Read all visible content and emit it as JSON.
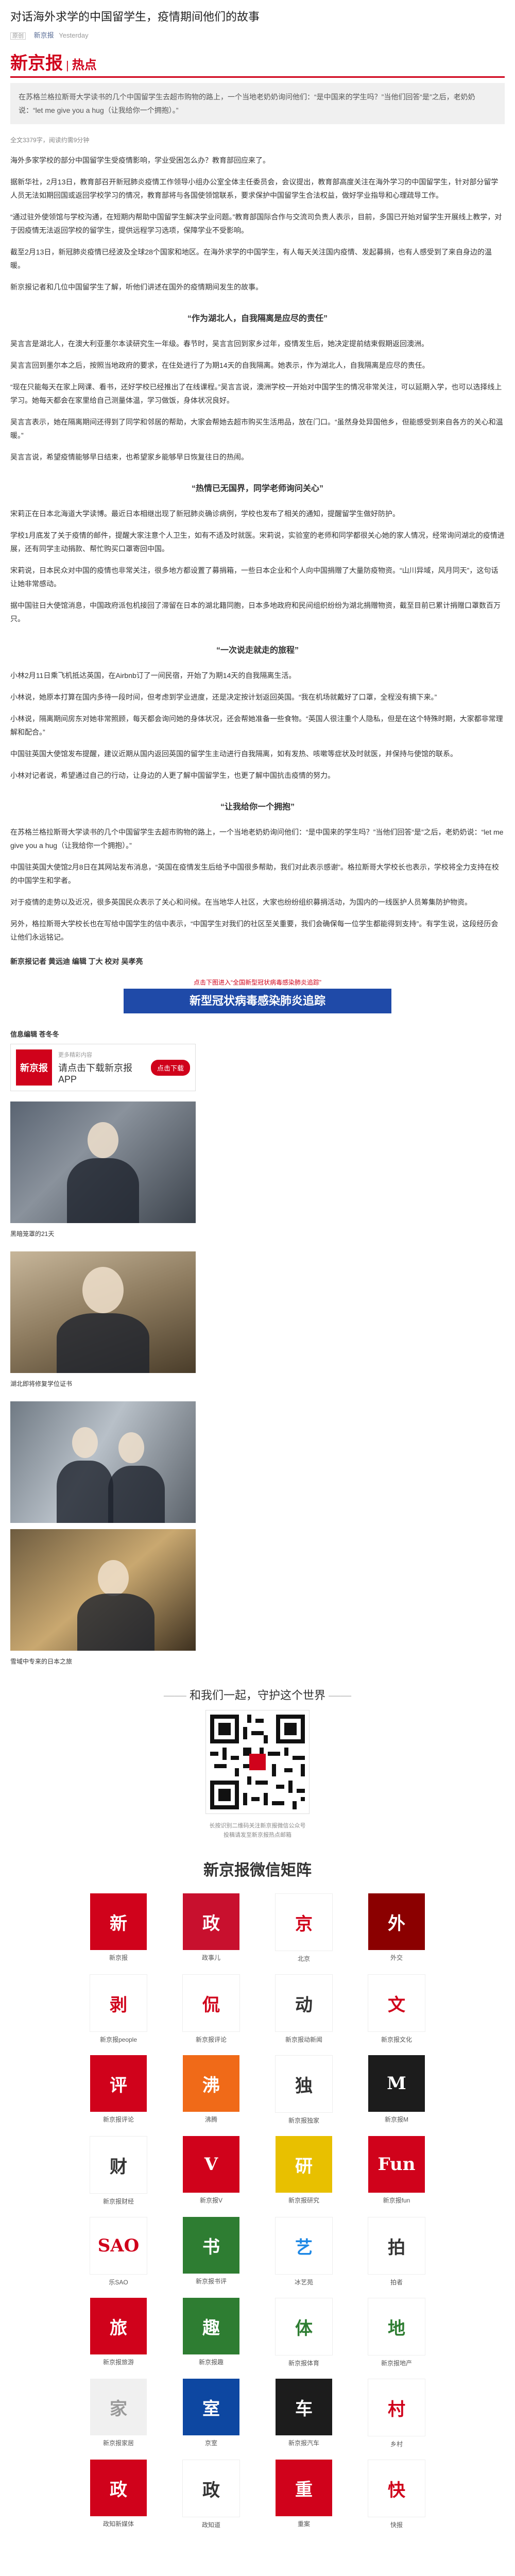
{
  "header": {
    "title": "对话海外求学的中国留学生，疫情期间他们的故事",
    "original_tag": "原创",
    "source": "新京报",
    "date": "Yesterday"
  },
  "brand": {
    "logo": "新京报",
    "section": "热点"
  },
  "summary": "在苏格兰格拉斯哥大学读书的几个中国留学生去超市购物的路上，一个当地老奶奶询问他们：“是中国来的学生吗？”当他们回答“是”之后，老奶奶说：“let me give you a hug（让我给你一个拥抱）。”",
  "note": "全文3379字，阅读约需9分钟",
  "paragraphs_a": [
    "海外多家学校的部分中国留学生受疫情影响，学业受困怎么办？教育部回应来了。",
    "据新华社，2月13日，教育部召开新冠肺炎疫情工作领导小组办公室全体主任委员会，会议提出，教育部高度关注在海外学习的中国留学生，针对部分留学人员无法如期回国或返回学校学习的情况，教育部将与各国使领馆联系，要求保护中国留学生合法权益，做好学业指导和心理疏导工作。",
    "“通过驻外使领馆与学校沟通，在短期内帮助中国留学生解决学业问题。”教育部国际合作与交流司负责人表示，目前，多国已开始对留学生开展线上教学，对于因疫情无法返回学校的留学生，提供远程学习选项，保障学业不受影响。",
    "截至2月13日，新冠肺炎疫情已经波及全球28个国家和地区。在海外求学的中国学生，有人每天关注国内疫情、发起募捐，也有人感受到了来自身边的温暖。",
    "新京报记者和几位中国留学生了解，听他们讲述在国外的疫情期间发生的故事。"
  ],
  "section1": {
    "heading": "“作为湖北人，自我隔离是应尽的责任”",
    "paragraphs": [
      "吴言言是湖北人，在澳大利亚墨尔本读研究生一年级。春节时，吴言言回到家乡过年，疫情发生后，她决定提前结束假期返回澳洲。",
      "吴言言回到墨尔本之后，按照当地政府的要求，在住处进行了为期14天的自我隔离。她表示，作为湖北人，自我隔离是应尽的责任。",
      "“现在只能每天在家上网课、看书，还好学校已经推出了在线课程。”吴言言说，澳洲学校一开始对中国学生的情况非常关注，可以延期入学，也可以选择线上学习。她每天都会在家里给自己测量体温，学习做饭，身体状况良好。",
      "吴言言表示，她在隔离期间还得到了同学和邻居的帮助，大家会帮她去超市购买生活用品，放在门口。“虽然身处异国他乡，但能感受到来自各方的关心和温暖。”",
      "吴言言说，希望疫情能够早日结束，也希望家乡能够早日恢复往日的热闹。"
    ]
  },
  "section2": {
    "heading": "“热情已无国界，同学老师询问关心”",
    "paragraphs": [
      "宋莉正在日本北海道大学读博。最近日本相继出现了新冠肺炎确诊病例，学校也发布了相关的通知，提醒留学生做好防护。",
      "学校1月底发了关于疫情的邮件，提醒大家注意个人卫生，如有不适及时就医。宋莉说，实验室的老师和同学都很关心她的家人情况，经常询问湖北的疫情进展，还有同学主动捐款、帮忙购买口罩寄回中国。",
      "宋莉说，日本民众对中国的疫情也非常关注，很多地方都设置了募捐箱，一些日本企业和个人向中国捐赠了大量防疫物资。“山川异域，风月同天”，这句话让她非常感动。",
      "据中国驻日大使馆消息，中国政府派包机接回了滞留在日本的湖北籍同胞，日本多地政府和民间组织纷纷为湖北捐赠物资，截至目前已累计捐赠口罩数百万只。"
    ]
  },
  "section3": {
    "heading": "“一次说走就走的旅程”",
    "paragraphs": [
      "小林2月11日乘飞机抵达英国，在Airbnb订了一间民宿，开始了为期14天的自我隔离生活。",
      "小林说，她原本打算在国内多待一段时间，但考虑到学业进度，还是决定按计划返回英国。“我在机场就戴好了口罩，全程没有摘下来。”",
      "小林说，隔离期间房东对她非常照顾，每天都会询问她的身体状况，还会帮她准备一些食物。“英国人很注重个人隐私，但是在这个特殊时期，大家都非常理解和配合。”",
      "中国驻英国大使馆发布提醒，建议近期从国内返回英国的留学生主动进行自我隔离，如有发热、咳嗽等症状及时就医，并保持与使馆的联系。",
      "小林对记者说，希望通过自己的行动，让身边的人更了解中国留学生，也更了解中国抗击疫情的努力。"
    ]
  },
  "section4": {
    "heading": "“让我给你一个拥抱”",
    "paragraphs": [
      "在苏格兰格拉斯哥大学读书的几个中国留学生去超市购物的路上，一个当地老奶奶询问他们：“是中国来的学生吗？”当他们回答“是”之后，老奶奶说：“let me give you a hug（让我给你一个拥抱）。”",
      "中国驻英国大使馆2月8日在其网站发布消息，“英国在疫情发生后给予中国很多帮助，我们对此表示感谢”。格拉斯哥大学校长也表示，学校将全力支持在校的中国学生和学者。",
      "对于疫情的走势以及近况，很多英国民众表示了关心和问候。在当地华人社区，大家也纷纷组织募捐活动，为国内的一线医护人员筹集防护物资。",
      "另外，格拉斯哥大学校长也在写给中国学生的信中表示，“中国学生对我们的社区至关重要，我们会确保每一位学生都能得到支持”。有学生说，这段经历会让他们永远铭记。"
    ]
  },
  "tags": "新京报记者 黄远迪 编辑 丁大 校对 吴孝亮",
  "banner": {
    "top": "点击下图进入“全国新型冠状病毒感染肺炎追踪”",
    "main": "新型冠状病毒感染肺炎追踪"
  },
  "captions": {
    "c1": "信息编辑 苍冬冬",
    "app_small": "更多精彩内容",
    "app_big": "请点击下载新京报APP",
    "app_btn": "点击下载",
    "c2": "黑暗笼罩的21天",
    "c3": "湖北即将修复学位证书",
    "c4": "雪域中专来的日本之旅"
  },
  "promo": {
    "heading": "和我们一起，守护这个世界",
    "qr_line1": "长按识别二维码关注新京报微信公众号",
    "qr_line2": "投稿请发至新京报热点邮箱"
  },
  "matrix": {
    "title": "新京报微信矩阵",
    "items": [
      {
        "logo": "新",
        "name": "新京报",
        "bg": "#d0021b",
        "fg": "#ffffff"
      },
      {
        "logo": "政",
        "name": "政事儿",
        "bg": "#c8102e",
        "fg": "#ffffff"
      },
      {
        "logo": "京",
        "name": "北京",
        "bg": "#ffffff",
        "fg": "#d0021b"
      },
      {
        "logo": "外",
        "name": "外交",
        "bg": "#8b0000",
        "fg": "#ffffff"
      },
      {
        "logo": "剥",
        "name": "新京报people",
        "bg": "#ffffff",
        "fg": "#d0021b"
      },
      {
        "logo": "侃",
        "name": "新京报评论",
        "bg": "#ffffff",
        "fg": "#d0021b"
      },
      {
        "logo": "动",
        "name": "新京报动新闻",
        "bg": "#ffffff",
        "fg": "#333333"
      },
      {
        "logo": "文",
        "name": "新京报文化",
        "bg": "#ffffff",
        "fg": "#d0021b"
      },
      {
        "logo": "评",
        "name": "新京报评论",
        "bg": "#d0021b",
        "fg": "#ffffff"
      },
      {
        "logo": "沸",
        "name": "沸腾",
        "bg": "#f06a18",
        "fg": "#ffffff"
      },
      {
        "logo": "独",
        "name": "新京报独家",
        "bg": "#ffffff",
        "fg": "#333333"
      },
      {
        "logo": "M",
        "name": "新京报M",
        "bg": "#1c1c1c",
        "fg": "#ffffff"
      },
      {
        "logo": "财",
        "name": "新京报财经",
        "bg": "#ffffff",
        "fg": "#333333"
      },
      {
        "logo": "V",
        "name": "新京报V",
        "bg": "#d0021b",
        "fg": "#ffffff"
      },
      {
        "logo": "研",
        "name": "新京报研究",
        "bg": "#e8c000",
        "fg": "#ffffff"
      },
      {
        "logo": "Fun",
        "name": "新京报fun",
        "bg": "#d0021b",
        "fg": "#ffffff"
      },
      {
        "logo": "SAO",
        "name": "乐SAO",
        "bg": "#ffffff",
        "fg": "#d0021b"
      },
      {
        "logo": "书",
        "name": "新京报书评",
        "bg": "#2e7d32",
        "fg": "#ffffff"
      },
      {
        "logo": "艺",
        "name": "冰艺苑",
        "bg": "#ffffff",
        "fg": "#1e88e5"
      },
      {
        "logo": "拍",
        "name": "拍者",
        "bg": "#ffffff",
        "fg": "#333333"
      },
      {
        "logo": "旅",
        "name": "新京报旅游",
        "bg": "#d0021b",
        "fg": "#ffffff"
      },
      {
        "logo": "趣",
        "name": "新京报趣",
        "bg": "#2e7d32",
        "fg": "#ffffff"
      },
      {
        "logo": "体",
        "name": "新京报体育",
        "bg": "#ffffff",
        "fg": "#2e7d32"
      },
      {
        "logo": "地",
        "name": "新京报地产",
        "bg": "#ffffff",
        "fg": "#2e7d32"
      },
      {
        "logo": "家",
        "name": "新京报家居",
        "bg": "#f0f0f0",
        "fg": "#999999"
      },
      {
        "logo": "室",
        "name": "京室",
        "bg": "#0d47a1",
        "fg": "#ffffff"
      },
      {
        "logo": "车",
        "name": "新京报汽车",
        "bg": "#1c1c1c",
        "fg": "#ffffff"
      },
      {
        "logo": "村",
        "name": "乡村",
        "bg": "#ffffff",
        "fg": "#d0021b"
      },
      {
        "logo": "政",
        "name": "政知新媒体",
        "bg": "#d0021b",
        "fg": "#ffffff"
      },
      {
        "logo": "政",
        "name": "政知道",
        "bg": "#ffffff",
        "fg": "#333333"
      },
      {
        "logo": "重",
        "name": "重案",
        "bg": "#d0021b",
        "fg": "#ffffff"
      },
      {
        "logo": "快",
        "name": "快报",
        "bg": "#ffffff",
        "fg": "#d0021b"
      }
    ]
  }
}
